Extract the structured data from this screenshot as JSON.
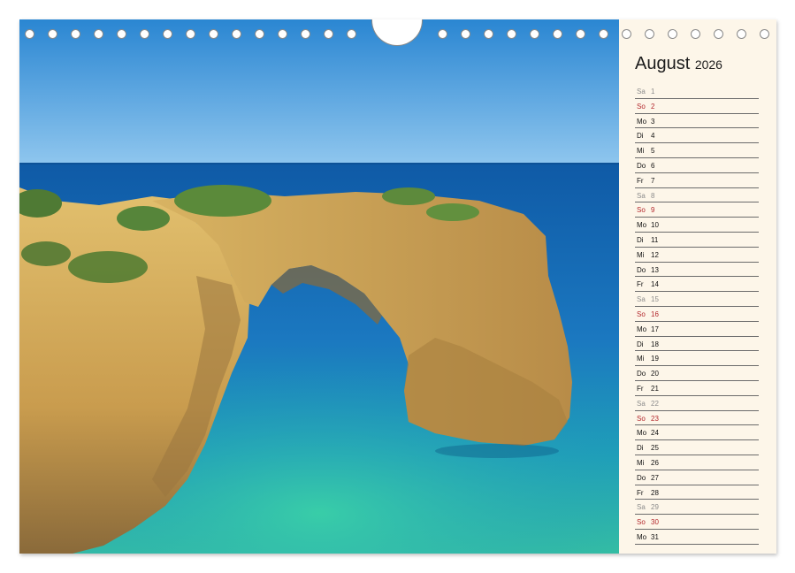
{
  "calendar": {
    "month": "August",
    "year": "2026",
    "days": [
      {
        "dn": "Sa",
        "num": "1",
        "type": "sat"
      },
      {
        "dn": "So",
        "num": "2",
        "type": "sun"
      },
      {
        "dn": "Mo",
        "num": "3",
        "type": "wd"
      },
      {
        "dn": "Di",
        "num": "4",
        "type": "wd"
      },
      {
        "dn": "Mi",
        "num": "5",
        "type": "wd"
      },
      {
        "dn": "Do",
        "num": "6",
        "type": "wd"
      },
      {
        "dn": "Fr",
        "num": "7",
        "type": "wd"
      },
      {
        "dn": "Sa",
        "num": "8",
        "type": "sat"
      },
      {
        "dn": "So",
        "num": "9",
        "type": "sun"
      },
      {
        "dn": "Mo",
        "num": "10",
        "type": "wd"
      },
      {
        "dn": "Di",
        "num": "11",
        "type": "wd"
      },
      {
        "dn": "Mi",
        "num": "12",
        "type": "wd"
      },
      {
        "dn": "Do",
        "num": "13",
        "type": "wd"
      },
      {
        "dn": "Fr",
        "num": "14",
        "type": "wd"
      },
      {
        "dn": "Sa",
        "num": "15",
        "type": "sat"
      },
      {
        "dn": "So",
        "num": "16",
        "type": "sun"
      },
      {
        "dn": "Mo",
        "num": "17",
        "type": "wd"
      },
      {
        "dn": "Di",
        "num": "18",
        "type": "wd"
      },
      {
        "dn": "Mi",
        "num": "19",
        "type": "wd"
      },
      {
        "dn": "Do",
        "num": "20",
        "type": "wd"
      },
      {
        "dn": "Fr",
        "num": "21",
        "type": "wd"
      },
      {
        "dn": "Sa",
        "num": "22",
        "type": "sat"
      },
      {
        "dn": "So",
        "num": "23",
        "type": "sun"
      },
      {
        "dn": "Mo",
        "num": "24",
        "type": "wd"
      },
      {
        "dn": "Di",
        "num": "25",
        "type": "wd"
      },
      {
        "dn": "Mi",
        "num": "26",
        "type": "wd"
      },
      {
        "dn": "Do",
        "num": "27",
        "type": "wd"
      },
      {
        "dn": "Fr",
        "num": "28",
        "type": "wd"
      },
      {
        "dn": "Sa",
        "num": "29",
        "type": "sat"
      },
      {
        "dn": "So",
        "num": "30",
        "type": "sun"
      },
      {
        "dn": "Mo",
        "num": "31",
        "type": "wd"
      }
    ]
  },
  "colors": {
    "sky": "#2e8fd6",
    "sea": "#1a6fb8",
    "lagoon": "#2bb7a4",
    "rock": "#d9b65f",
    "sunday": "#b3282d",
    "saturday": "#8c8c8c",
    "sidebar_bg": "#fdf6e9"
  },
  "photo": {
    "subject": "sea-arch-photo"
  }
}
